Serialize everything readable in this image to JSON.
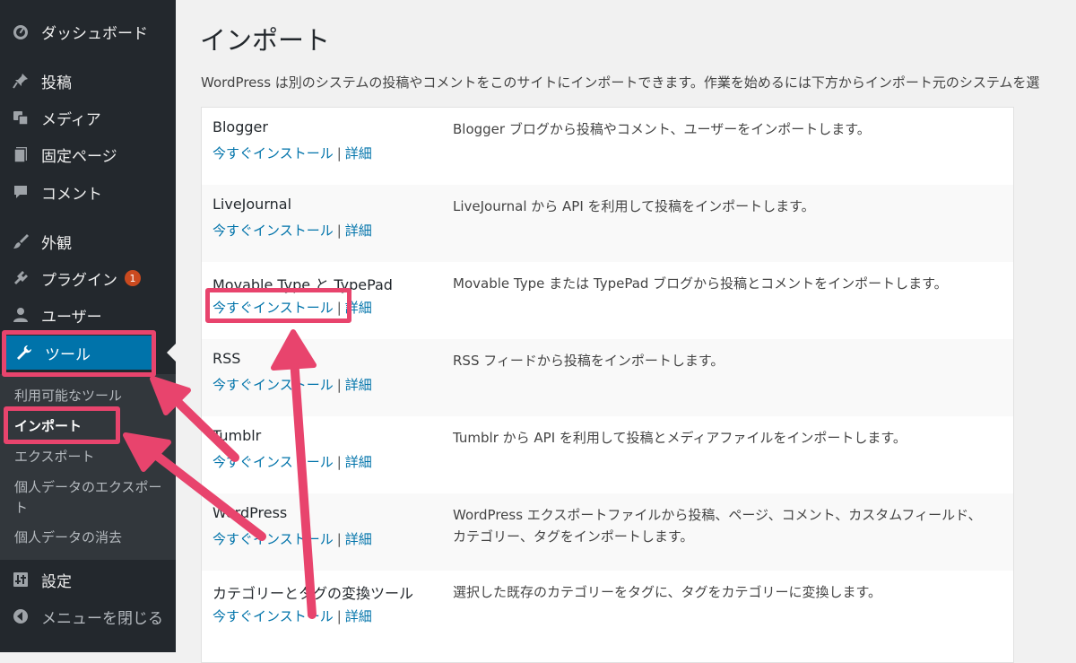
{
  "sidebar": {
    "items": [
      {
        "label": "ダッシュボード",
        "icon": "dashboard-icon"
      },
      {
        "label": "投稿",
        "icon": "pin-icon"
      },
      {
        "label": "メディア",
        "icon": "media-icon"
      },
      {
        "label": "固定ページ",
        "icon": "page-icon"
      },
      {
        "label": "コメント",
        "icon": "comment-icon"
      },
      {
        "label": "外観",
        "icon": "brush-icon"
      },
      {
        "label": "プラグイン",
        "icon": "plugin-icon",
        "badge": "1"
      },
      {
        "label": "ユーザー",
        "icon": "user-icon"
      },
      {
        "label": "ツール",
        "icon": "wrench-icon"
      },
      {
        "label": "設定",
        "icon": "settings-icon"
      },
      {
        "label": "メニューを閉じる",
        "icon": "collapse-icon"
      }
    ],
    "submenu": [
      {
        "label": "利用可能なツール"
      },
      {
        "label": "インポート"
      },
      {
        "label": "エクスポート"
      },
      {
        "label": "個人データのエクスポート"
      },
      {
        "label": "個人データの消去"
      }
    ]
  },
  "main": {
    "title": "インポート",
    "intro": "WordPress は別のシステムの投稿やコメントをこのサイトにインポートできます。作業を始めるには下方からインポート元のシステムを選",
    "install_label": "今すぐインストール",
    "details_label": "詳細",
    "separator": "|",
    "importers": [
      {
        "name": "Blogger",
        "desc": "Blogger ブログから投稿やコメント、ユーザーをインポートします。"
      },
      {
        "name": "LiveJournal",
        "desc": "LiveJournal から API を利用して投稿をインポートします。"
      },
      {
        "name": "Movable Type と TypePad",
        "desc": "Movable Type または TypePad ブログから投稿とコメントをインポートします。"
      },
      {
        "name": "RSS",
        "desc": "RSS フィードから投稿をインポートします。"
      },
      {
        "name": "Tumblr",
        "desc": "Tumblr から API を利用して投稿とメディアファイルをインポートします。"
      },
      {
        "name": "WordPress",
        "desc": "WordPress エクスポートファイルから投稿、ページ、コメント、カスタムフィールド、カテゴリー、タグをインポートします。"
      },
      {
        "name": "カテゴリーとタグの変換ツール",
        "desc": "選択した既存のカテゴリーをタグに、タグをカテゴリーに変換します。"
      }
    ]
  },
  "colors": {
    "sidebar_bg": "#23282d",
    "submenu_bg": "#32373c",
    "active_bg": "#0073aa",
    "link": "#0073aa",
    "highlight": "#e8446d",
    "badge": "#ca4a1f"
  }
}
